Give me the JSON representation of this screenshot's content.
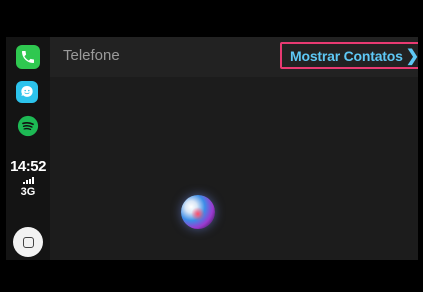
{
  "sidebar": {
    "apps": [
      {
        "name": "phone",
        "icon": "phone-icon",
        "color": "#2fc850"
      },
      {
        "name": "waze",
        "icon": "waze-icon",
        "color": "#2cc3ec"
      },
      {
        "name": "spotify",
        "icon": "spotify-icon",
        "color": "#1db954"
      }
    ],
    "status": {
      "time": "14:52",
      "network": "3G",
      "signal_bars": 4
    }
  },
  "header": {
    "title": "Telefone",
    "contacts_link": "Mostrar Contatos",
    "highlight_color": "#e83a72",
    "link_color": "#5ec8f5"
  },
  "main": {
    "assistant_icon": "siri-icon"
  }
}
